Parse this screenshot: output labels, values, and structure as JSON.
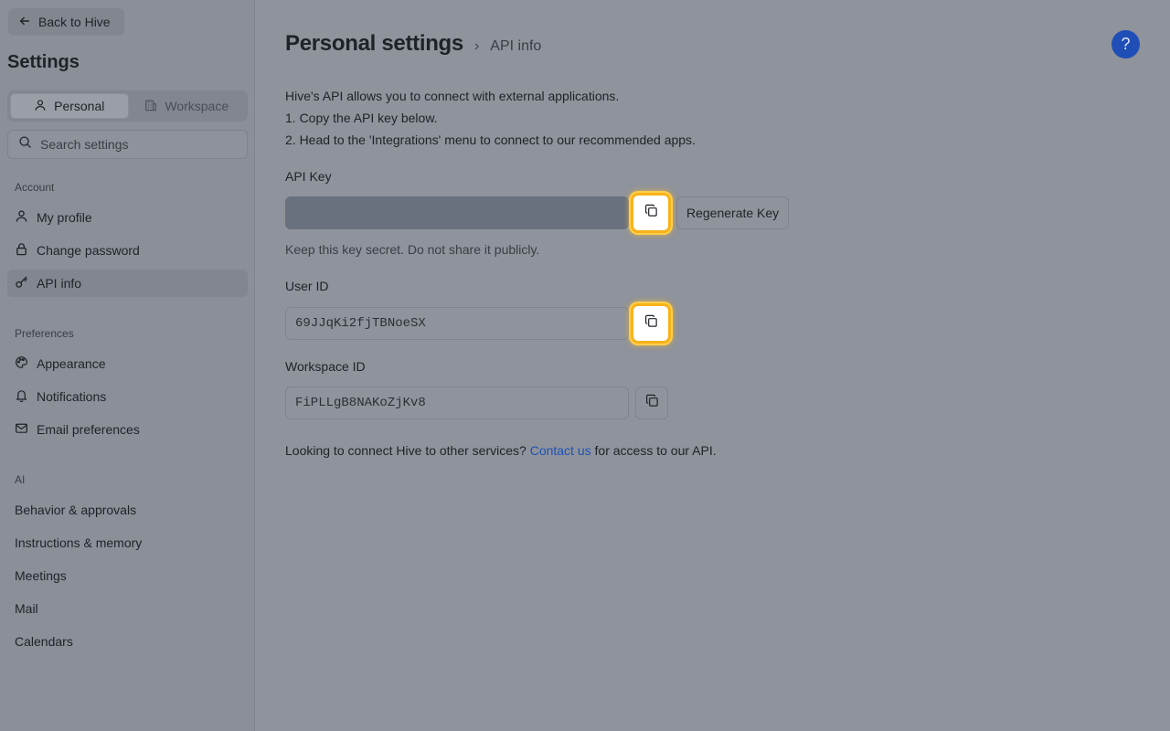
{
  "sidebar": {
    "back_label": "Back to Hive",
    "title": "Settings",
    "tabs": [
      {
        "label": "Personal",
        "icon": "person-icon"
      },
      {
        "label": "Workspace",
        "icon": "building-icon"
      }
    ],
    "search_placeholder": "Search settings",
    "sections": [
      {
        "label": "Account",
        "items": [
          {
            "label": "My profile",
            "icon": "person-icon"
          },
          {
            "label": "Change password",
            "icon": "lock-icon"
          },
          {
            "label": "API info",
            "icon": "key-icon",
            "active": true
          }
        ]
      },
      {
        "label": "Preferences",
        "items": [
          {
            "label": "Appearance",
            "icon": "palette-icon"
          },
          {
            "label": "Notifications",
            "icon": "bell-icon"
          },
          {
            "label": "Email preferences",
            "icon": "mail-icon"
          }
        ]
      },
      {
        "label": "AI",
        "items": [
          {
            "label": "Behavior & approvals"
          },
          {
            "label": "Instructions & memory"
          },
          {
            "label": "Meetings"
          },
          {
            "label": "Mail"
          },
          {
            "label": "Calendars"
          }
        ]
      }
    ]
  },
  "main": {
    "breadcrumb_title": "Personal settings",
    "breadcrumb_sep": "›",
    "breadcrumb_sub": "API info",
    "help_label": "?",
    "intro": [
      "Hive's API allows you to connect with external applications.",
      "1. Copy the API key below.",
      "2. Head to the 'Integrations' menu to connect to our recommended apps."
    ],
    "api_key_label": "API Key",
    "api_key_value": "",
    "regenerate_label": "Regenerate Key",
    "api_key_hint": "Keep this key secret. Do not share it publicly.",
    "user_id_label": "User ID",
    "user_id_value": "69JJqKi2fjTBNoeSX",
    "workspace_id_label": "Workspace ID",
    "workspace_id_value": "FiPLLgB8NAKoZjKv8",
    "footer_prefix": "Looking to connect Hive to other services?",
    "footer_link": "Contact us",
    "footer_suffix": "for access to our API."
  },
  "colors": {
    "accent_link": "#1f52b8",
    "help_button": "#1f4eb6",
    "highlight_ring": "#f7b21b"
  }
}
